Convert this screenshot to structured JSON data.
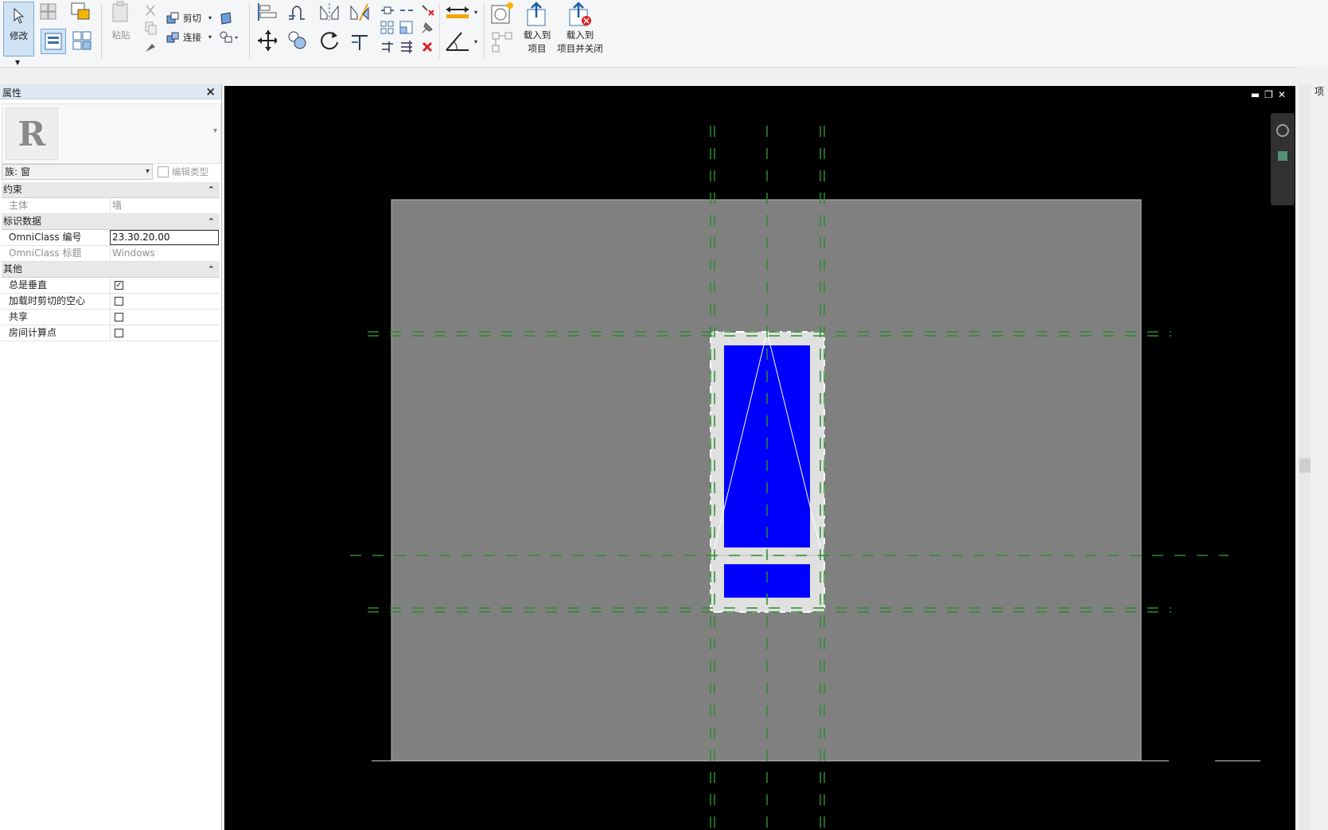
{
  "ribbon": {
    "modify_label": "修改",
    "cut_label": "剪切",
    "join_label": "连接",
    "paste_label": "粘贴",
    "load_to_project_line1": "载入到",
    "load_to_project_line2": "项目",
    "load_and_close_line1": "载入到",
    "load_and_close_line2": "项目并关闭"
  },
  "properties": {
    "title": "属性",
    "family_type": "族: 窗",
    "edit_type_label": "编辑类型",
    "groups": [
      {
        "name": "约束",
        "rows": [
          {
            "key": "主体",
            "value": "墙"
          }
        ]
      },
      {
        "name": "标识数据",
        "rows": [
          {
            "key": "OmniClass 编号",
            "value": "23.30.20.00"
          },
          {
            "key": "OmniClass 标题",
            "value": "Windows"
          }
        ]
      },
      {
        "name": "其他",
        "rows": [
          {
            "key": "总是垂直",
            "checked": true
          },
          {
            "key": "加载时剪切的空心",
            "checked": false
          },
          {
            "key": "共享",
            "checked": false
          },
          {
            "key": "房间计算点",
            "checked": false
          }
        ]
      }
    ]
  },
  "right_panel": {
    "tab_label": "项"
  },
  "colors": {
    "viewport_bg": "#000000",
    "wall": "#808080",
    "glass": "#0000ff",
    "frame": "#e0e0e0",
    "reference_line": "#2e8b2e"
  }
}
